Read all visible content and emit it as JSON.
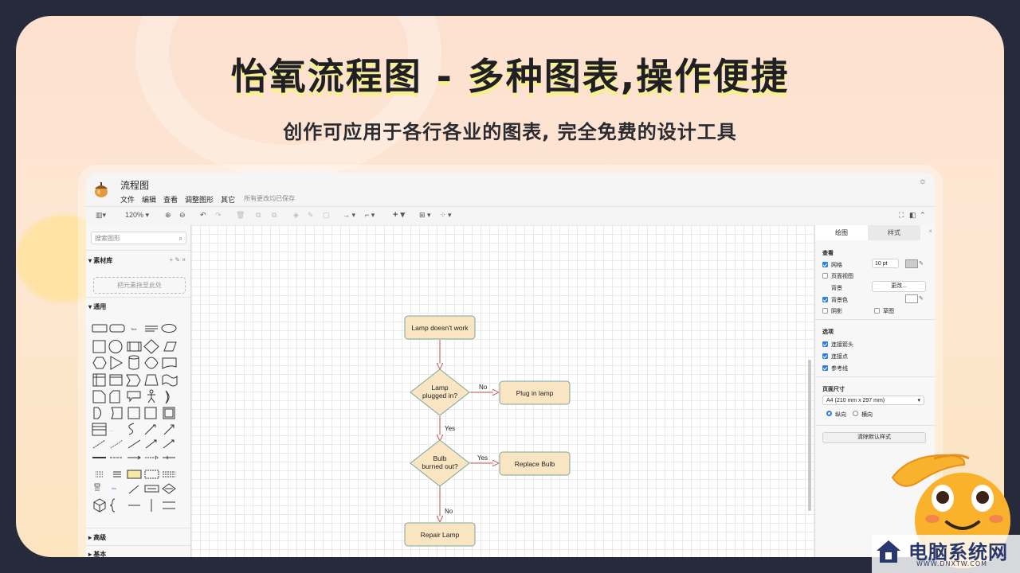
{
  "banner": {
    "headline": "怡氧流程图 - 多种图表,操作便捷",
    "subline": "创作可应用于各行各业的图表, 完全免费的设计工具"
  },
  "window": {
    "doc_title": "流程图",
    "menu": [
      "文件",
      "编辑",
      "查看",
      "调整图形",
      "其它"
    ],
    "save_status": "所有更改均已保存",
    "zoom": "120%"
  },
  "sidebar": {
    "search_placeholder": "搜索图形",
    "library_title": "素材库",
    "library_tools": "+ ✎ ×",
    "dropzone": "把元素拖至此处",
    "section_general": "通用",
    "section_advanced": "高级",
    "section_basic": "基本"
  },
  "flowchart": {
    "nodes": {
      "start": "Lamp doesn't work",
      "q1_line1": "Lamp",
      "q1_line2": "plugged in?",
      "plug": "Plug in lamp",
      "q2_line1": "Bulb",
      "q2_line2": "burned out?",
      "replace": "Replace Bulb",
      "repair": "Repair Lamp"
    },
    "edges": {
      "q1_right": "No",
      "q1_down": "Yes",
      "q2_right": "Yes",
      "q2_down": "No"
    },
    "colors": {
      "fill": "#fae5c2",
      "stroke": "#7aa69a",
      "arrow": "#c0504d"
    }
  },
  "format_panel": {
    "tab_diagram": "绘图",
    "tab_style": "样式",
    "view_title": "查看",
    "grid_label": "网格",
    "grid_value": "10 pt",
    "page_view_label": "页面视图",
    "background_label": "背景",
    "change_button": "更改...",
    "bg_color_label": "背景色",
    "shadow_label": "阴影",
    "sketch_label": "草图",
    "options_title": "选项",
    "connection_arrows": "连接箭头",
    "connection_points": "连接点",
    "guides": "参考线",
    "page_size_title": "页面尺寸",
    "page_size_value": "A4 (210 mm x 297 mm)",
    "portrait": "纵向",
    "landscape": "横向",
    "clear_style_button": "清除默认样式"
  },
  "watermark": {
    "text": "电脑系统网",
    "url": "WWW.DNXTW.COM"
  }
}
